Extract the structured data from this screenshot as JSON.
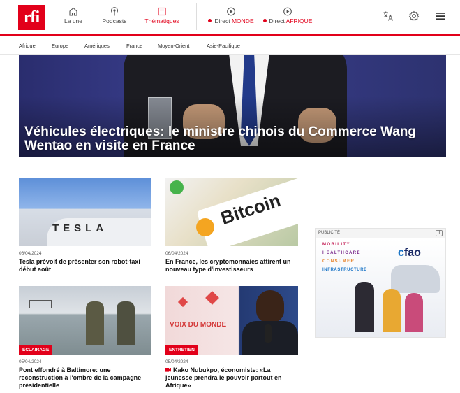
{
  "header": {
    "logo": "rfi",
    "nav": [
      {
        "label": "La une",
        "icon": "home-icon"
      },
      {
        "label": "Podcasts",
        "icon": "podcast-icon"
      },
      {
        "label": "Thématiques",
        "icon": "thematiques-icon"
      }
    ],
    "direct": [
      {
        "prefix": "Direct",
        "name": "MONDE"
      },
      {
        "prefix": "Direct",
        "name": "AFRIQUE"
      }
    ],
    "accent": "#e2001a"
  },
  "subnav": [
    "Afrique",
    "Europe",
    "Amériques",
    "France",
    "Moyen-Orient",
    "Asie-Pacifique"
  ],
  "hero": {
    "title": "Véhicules électriques: le ministre chinois du Commerce Wang Wentao en visite en France"
  },
  "articles": [
    {
      "date": "06/04/2024",
      "title": "Tesla prévoit de présenter son robot-taxi début août",
      "badge": "",
      "image_text": "TESLA"
    },
    {
      "date": "06/04/2024",
      "title": "En France, les cryptomonnaies attirent un nouveau type d'investisseurs",
      "badge": "",
      "image_text": "Bitcoin"
    },
    {
      "date": "05/04/2024",
      "title": "Pont effondré à Baltimore: une reconstruction à l'ombre de la campagne présidentielle",
      "badge": "ÉCLAIRAGE",
      "image_text": ""
    },
    {
      "date": "05/04/2024",
      "title": "Kako Nubukpo, économiste: «La jeunesse prendra le pouvoir partout en Afrique»",
      "badge": "ENTRETIEN",
      "image_text": "VOIX DU MONDE"
    }
  ],
  "ad": {
    "label": "PUBLICITÉ",
    "keywords": [
      "MOBILITY",
      "HEALTHCARE",
      "CONSUMER",
      "INFRASTRUCTURE"
    ],
    "brand_c": "c",
    "brand_rest": "fao"
  }
}
